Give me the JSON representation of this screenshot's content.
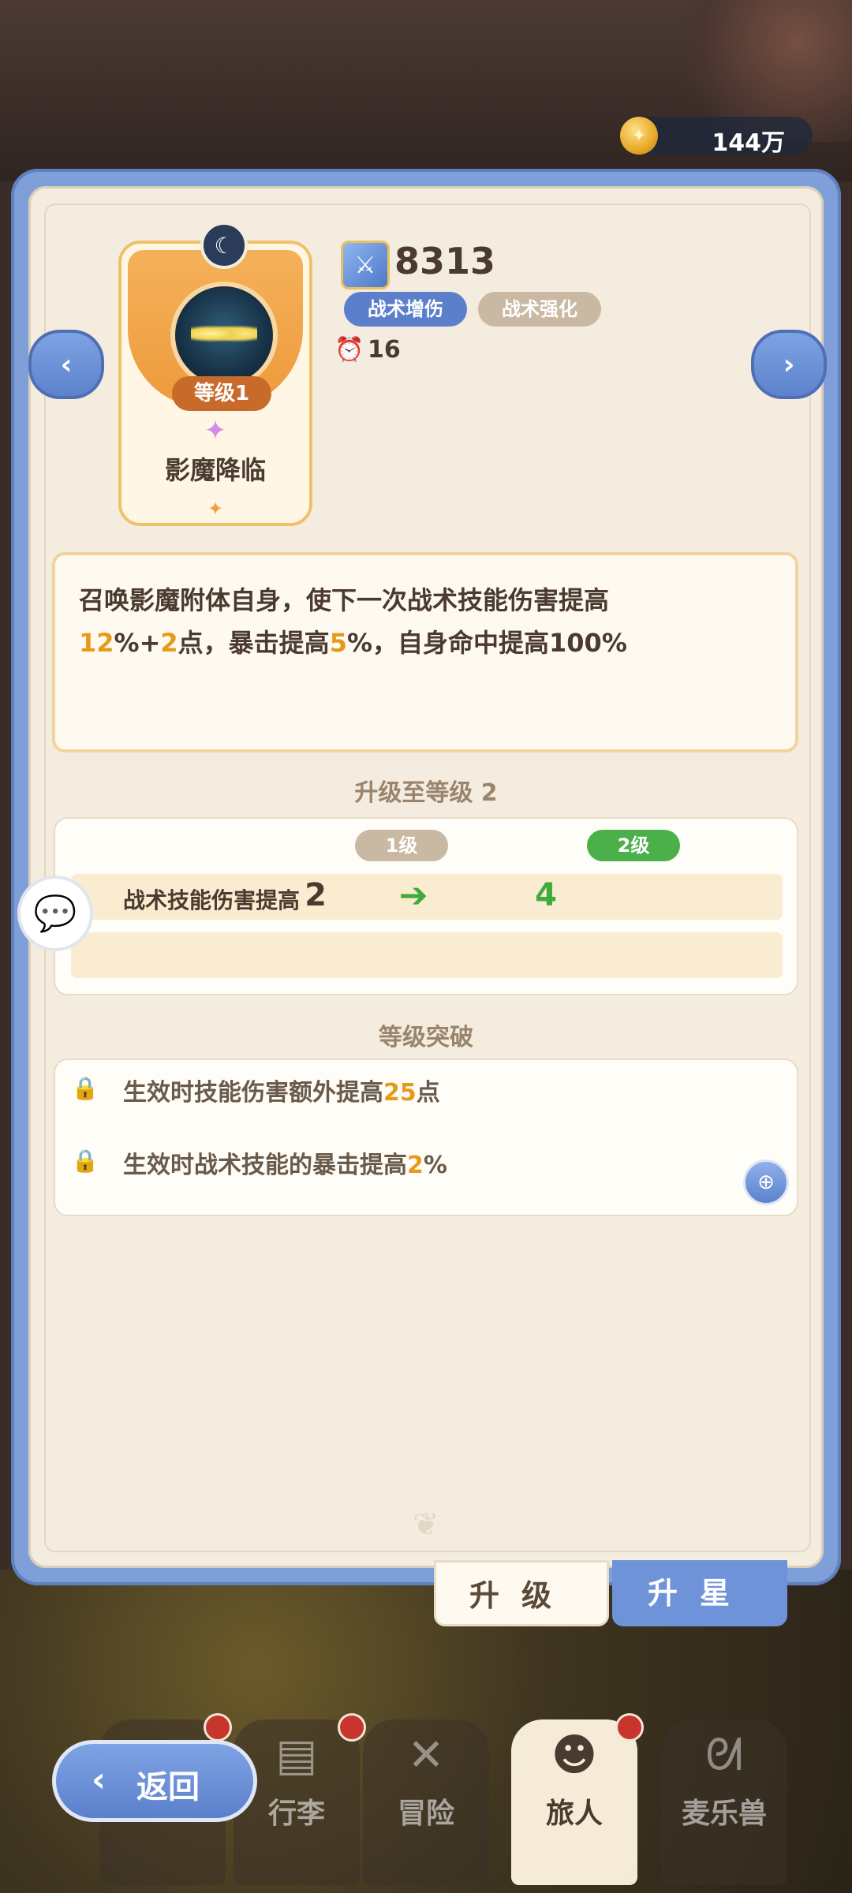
{
  "currency": {
    "icon": "coin-icon",
    "value": "144万"
  },
  "skill": {
    "name": "影魔降临",
    "level_label": "等级1",
    "power": "8313",
    "tags": [
      "战术增伤",
      "战术强化"
    ],
    "cooldown": "16"
  },
  "description": {
    "line1": "召唤影魔附体自身，使下一次战术技能伤害提高",
    "l2_a": "12",
    "l2_b": "%+",
    "l2_c": "2",
    "l2_d": "点，暴击提高",
    "l2_e": "5",
    "l2_f": "%，自身命中提高100%"
  },
  "upgrade": {
    "title": "升级至等级 2",
    "from_label": "1级",
    "to_label": "2级",
    "rows": [
      {
        "label": "战术技能伤害提高",
        "from": "2",
        "to": "4"
      }
    ]
  },
  "breakthrough": {
    "title": "等级突破",
    "items": [
      {
        "pre": "生效时技能伤害额外提高",
        "value": "25",
        "post": "点"
      },
      {
        "pre": "生效时战术技能的暴击提高",
        "value": "2",
        "post": "%"
      }
    ]
  },
  "actions": {
    "upgrade": "升级",
    "star": "升星"
  },
  "back": {
    "label": "返回"
  },
  "nav": [
    {
      "label": "",
      "icon": "bag-icon"
    },
    {
      "label": "行李",
      "icon": "chest-icon"
    },
    {
      "label": "冒险",
      "icon": "swords-icon"
    },
    {
      "label": "旅人",
      "icon": "character-icon"
    },
    {
      "label": "麦乐兽",
      "icon": "pet-icon"
    }
  ],
  "colors": {
    "accent": "#6f93d9",
    "highlight": "#e69a1c",
    "green": "#3fab3d"
  }
}
